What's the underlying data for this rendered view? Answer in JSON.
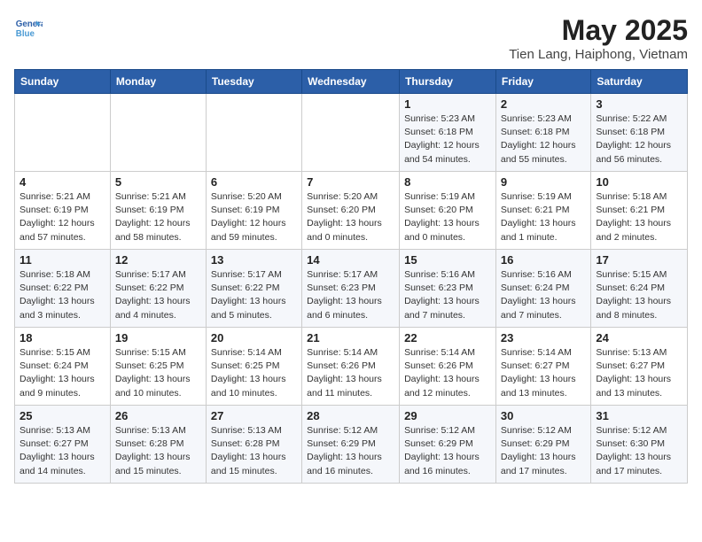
{
  "header": {
    "logo_line1": "General",
    "logo_line2": "Blue",
    "month": "May 2025",
    "location": "Tien Lang, Haiphong, Vietnam"
  },
  "weekdays": [
    "Sunday",
    "Monday",
    "Tuesday",
    "Wednesday",
    "Thursday",
    "Friday",
    "Saturday"
  ],
  "weeks": [
    [
      {
        "day": "",
        "detail": ""
      },
      {
        "day": "",
        "detail": ""
      },
      {
        "day": "",
        "detail": ""
      },
      {
        "day": "",
        "detail": ""
      },
      {
        "day": "1",
        "detail": "Sunrise: 5:23 AM\nSunset: 6:18 PM\nDaylight: 12 hours\nand 54 minutes."
      },
      {
        "day": "2",
        "detail": "Sunrise: 5:23 AM\nSunset: 6:18 PM\nDaylight: 12 hours\nand 55 minutes."
      },
      {
        "day": "3",
        "detail": "Sunrise: 5:22 AM\nSunset: 6:18 PM\nDaylight: 12 hours\nand 56 minutes."
      }
    ],
    [
      {
        "day": "4",
        "detail": "Sunrise: 5:21 AM\nSunset: 6:19 PM\nDaylight: 12 hours\nand 57 minutes."
      },
      {
        "day": "5",
        "detail": "Sunrise: 5:21 AM\nSunset: 6:19 PM\nDaylight: 12 hours\nand 58 minutes."
      },
      {
        "day": "6",
        "detail": "Sunrise: 5:20 AM\nSunset: 6:19 PM\nDaylight: 12 hours\nand 59 minutes."
      },
      {
        "day": "7",
        "detail": "Sunrise: 5:20 AM\nSunset: 6:20 PM\nDaylight: 13 hours\nand 0 minutes."
      },
      {
        "day": "8",
        "detail": "Sunrise: 5:19 AM\nSunset: 6:20 PM\nDaylight: 13 hours\nand 0 minutes."
      },
      {
        "day": "9",
        "detail": "Sunrise: 5:19 AM\nSunset: 6:21 PM\nDaylight: 13 hours\nand 1 minute."
      },
      {
        "day": "10",
        "detail": "Sunrise: 5:18 AM\nSunset: 6:21 PM\nDaylight: 13 hours\nand 2 minutes."
      }
    ],
    [
      {
        "day": "11",
        "detail": "Sunrise: 5:18 AM\nSunset: 6:22 PM\nDaylight: 13 hours\nand 3 minutes."
      },
      {
        "day": "12",
        "detail": "Sunrise: 5:17 AM\nSunset: 6:22 PM\nDaylight: 13 hours\nand 4 minutes."
      },
      {
        "day": "13",
        "detail": "Sunrise: 5:17 AM\nSunset: 6:22 PM\nDaylight: 13 hours\nand 5 minutes."
      },
      {
        "day": "14",
        "detail": "Sunrise: 5:17 AM\nSunset: 6:23 PM\nDaylight: 13 hours\nand 6 minutes."
      },
      {
        "day": "15",
        "detail": "Sunrise: 5:16 AM\nSunset: 6:23 PM\nDaylight: 13 hours\nand 7 minutes."
      },
      {
        "day": "16",
        "detail": "Sunrise: 5:16 AM\nSunset: 6:24 PM\nDaylight: 13 hours\nand 7 minutes."
      },
      {
        "day": "17",
        "detail": "Sunrise: 5:15 AM\nSunset: 6:24 PM\nDaylight: 13 hours\nand 8 minutes."
      }
    ],
    [
      {
        "day": "18",
        "detail": "Sunrise: 5:15 AM\nSunset: 6:24 PM\nDaylight: 13 hours\nand 9 minutes."
      },
      {
        "day": "19",
        "detail": "Sunrise: 5:15 AM\nSunset: 6:25 PM\nDaylight: 13 hours\nand 10 minutes."
      },
      {
        "day": "20",
        "detail": "Sunrise: 5:14 AM\nSunset: 6:25 PM\nDaylight: 13 hours\nand 10 minutes."
      },
      {
        "day": "21",
        "detail": "Sunrise: 5:14 AM\nSunset: 6:26 PM\nDaylight: 13 hours\nand 11 minutes."
      },
      {
        "day": "22",
        "detail": "Sunrise: 5:14 AM\nSunset: 6:26 PM\nDaylight: 13 hours\nand 12 minutes."
      },
      {
        "day": "23",
        "detail": "Sunrise: 5:14 AM\nSunset: 6:27 PM\nDaylight: 13 hours\nand 13 minutes."
      },
      {
        "day": "24",
        "detail": "Sunrise: 5:13 AM\nSunset: 6:27 PM\nDaylight: 13 hours\nand 13 minutes."
      }
    ],
    [
      {
        "day": "25",
        "detail": "Sunrise: 5:13 AM\nSunset: 6:27 PM\nDaylight: 13 hours\nand 14 minutes."
      },
      {
        "day": "26",
        "detail": "Sunrise: 5:13 AM\nSunset: 6:28 PM\nDaylight: 13 hours\nand 15 minutes."
      },
      {
        "day": "27",
        "detail": "Sunrise: 5:13 AM\nSunset: 6:28 PM\nDaylight: 13 hours\nand 15 minutes."
      },
      {
        "day": "28",
        "detail": "Sunrise: 5:12 AM\nSunset: 6:29 PM\nDaylight: 13 hours\nand 16 minutes."
      },
      {
        "day": "29",
        "detail": "Sunrise: 5:12 AM\nSunset: 6:29 PM\nDaylight: 13 hours\nand 16 minutes."
      },
      {
        "day": "30",
        "detail": "Sunrise: 5:12 AM\nSunset: 6:29 PM\nDaylight: 13 hours\nand 17 minutes."
      },
      {
        "day": "31",
        "detail": "Sunrise: 5:12 AM\nSunset: 6:30 PM\nDaylight: 13 hours\nand 17 minutes."
      }
    ]
  ]
}
